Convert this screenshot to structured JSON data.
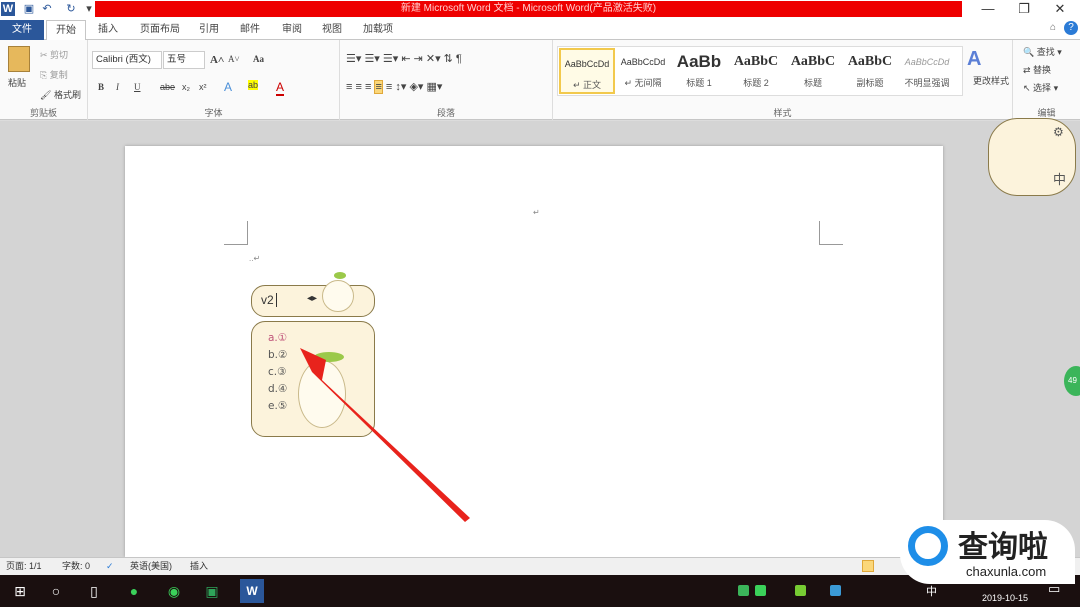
{
  "titlebar": {
    "title": "新建 Microsoft Word 文档 - Microsoft Word(产品激活失败)",
    "app_icon": "W",
    "minimize": "—",
    "restore": "❐",
    "close": "✕"
  },
  "tabs": [
    "文件",
    "开始",
    "插入",
    "页面布局",
    "引用",
    "邮件",
    "审阅",
    "视图",
    "加载项"
  ],
  "ribbon": {
    "clipboard": {
      "paste": "粘贴",
      "cut": "剪切",
      "copy": "复制",
      "format_painter": "格式刷",
      "label": "剪贴板"
    },
    "font": {
      "font_name": "Calibri (西文)",
      "font_size": "五号",
      "label": "字体",
      "bold": "B",
      "italic": "I",
      "underline": "U",
      "strike": "abe",
      "sub": "x₂",
      "sup": "x²",
      "grow": "A˄",
      "shrink": "A˅",
      "case": "Aa",
      "color": "A"
    },
    "paragraph": {
      "label": "段落"
    },
    "styles": {
      "label": "样式",
      "items": [
        {
          "preview": "AaBbCcDd",
          "name": "↵ 正文"
        },
        {
          "preview": "AaBbCcDd",
          "name": "↵ 无间隔"
        },
        {
          "preview": "AaBb",
          "name": "标题 1"
        },
        {
          "preview": "AaBbC",
          "name": "标题 2"
        },
        {
          "preview": "AaBbC",
          "name": "标题"
        },
        {
          "preview": "AaBbC",
          "name": "副标题"
        },
        {
          "preview": "AaBbCcDd",
          "name": "不明显强调"
        }
      ],
      "change": "更改样式"
    },
    "editing": {
      "label": "编辑",
      "find": "查找",
      "replace": "替换",
      "select": "选择"
    }
  },
  "document": {
    "para_mark": "↵",
    "line_text": "..↵"
  },
  "ime": {
    "input": "v2",
    "candidates": [
      {
        "key": "a.",
        "value": "①"
      },
      {
        "key": "b.",
        "value": "②"
      },
      {
        "key": "c.",
        "value": "③"
      },
      {
        "key": "d.",
        "value": "④"
      },
      {
        "key": "e.",
        "value": "⑤"
      }
    ],
    "mode": "中"
  },
  "status": {
    "page": "页面: 1/1",
    "words": "字数: 0",
    "language": "英语(美国)",
    "mode": "插入"
  },
  "taskbar": {
    "date": "2019-10-15",
    "ime": "中"
  },
  "watermark": {
    "text": "查询啦",
    "url": "chaxunla.com"
  },
  "side_badge": "49",
  "colors": {
    "accent": "#2b579a",
    "title_red": "#e00000",
    "arrow": "#e8231c"
  }
}
